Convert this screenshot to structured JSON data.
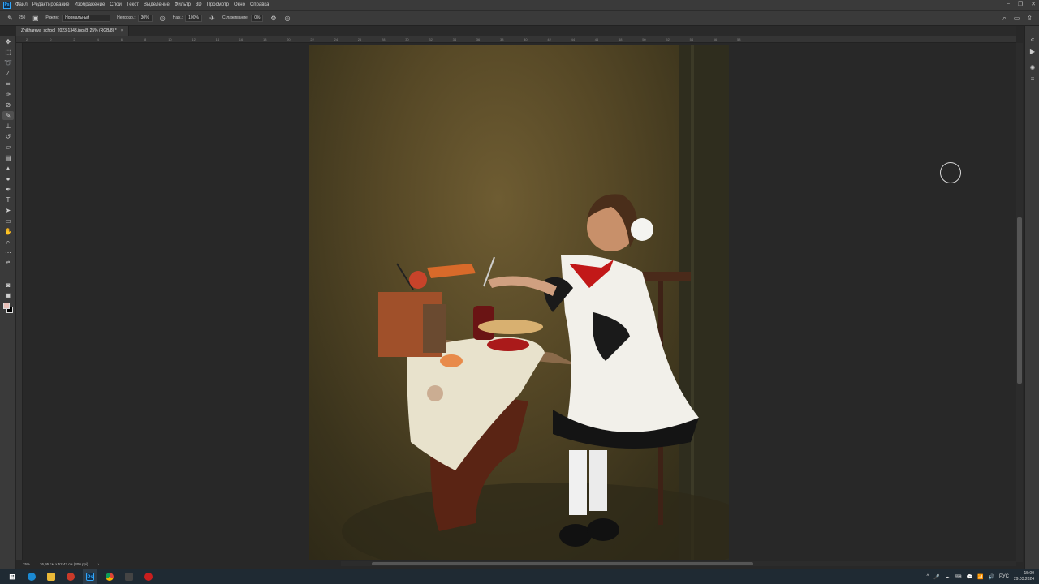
{
  "menubar": {
    "logo": "Ps",
    "items": [
      "Файл",
      "Редактирование",
      "Изображение",
      "Слои",
      "Текст",
      "Выделение",
      "Фильтр",
      "3D",
      "Просмотр",
      "Окно",
      "Справка"
    ]
  },
  "options": {
    "brush_size": "250",
    "mode_label": "Режим:",
    "mode_value": "Нормальный",
    "opacity_label": "Непрозр.:",
    "opacity_value": "30%",
    "flow_label": "Наж.:",
    "flow_value": "100%",
    "smoothing_label": "Сглаживание:",
    "smoothing_value": "0%"
  },
  "document": {
    "tab_title": "Zhikhareva_school_2023-1343.jpg @ 25% (RGB/8) *",
    "close_glyph": "×"
  },
  "ruler": {
    "ticks": [
      "2",
      "0",
      "2",
      "4",
      "6",
      "8",
      "10",
      "12",
      "14",
      "16",
      "18",
      "20",
      "22",
      "24",
      "26",
      "28",
      "30",
      "32",
      "34",
      "36",
      "38",
      "40",
      "42",
      "44",
      "46",
      "48",
      "50",
      "52",
      "54",
      "56",
      "58"
    ]
  },
  "status": {
    "zoom": "25%",
    "dimensions": "36,95 см x 52,43 см (300 ppi)",
    "arrow": "›"
  },
  "taskbar": {
    "tray": [
      "^",
      "🎤",
      "☁",
      "⌨",
      "💬",
      "📶",
      "🔊",
      "РУС"
    ],
    "time": "15:00",
    "date": "29.03.2024"
  },
  "colors": {
    "foreground": "#e8c0b8",
    "background": "#000000",
    "accent": "#31a8ff"
  }
}
